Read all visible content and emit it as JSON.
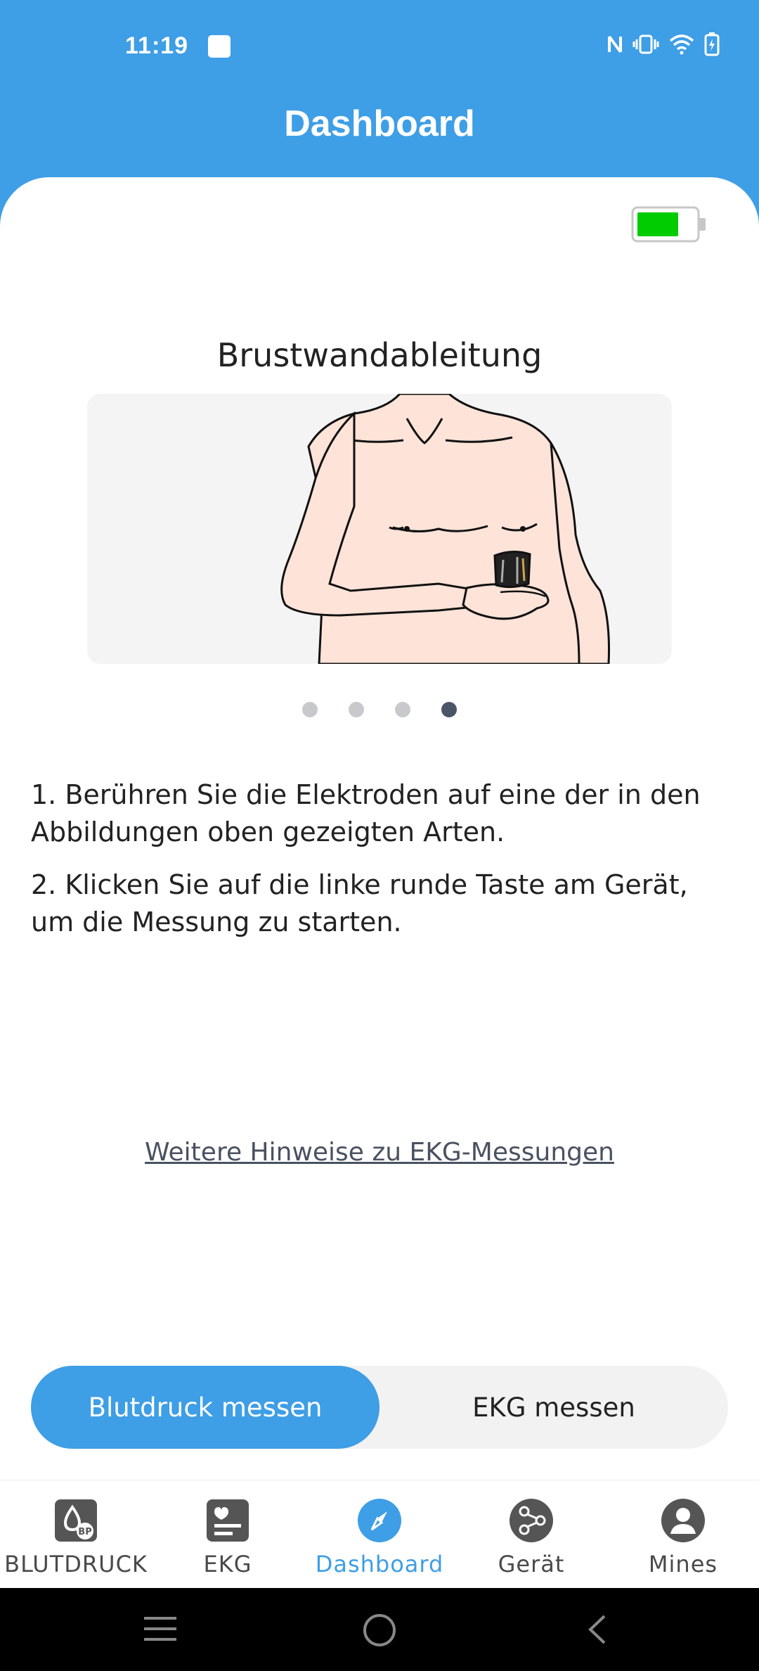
{
  "status_bar": {
    "time": "11:19",
    "icons": [
      "nfc-icon",
      "vibrate-icon",
      "wifi-icon",
      "battery-charging-icon"
    ]
  },
  "app": {
    "title": "Dashboard"
  },
  "device_battery": {
    "level_fraction": 0.85,
    "color": "#00cc00",
    "icon": "battery-icon"
  },
  "carousel": {
    "title": "Brustwandableitung",
    "page_count": 4,
    "active_page": 4
  },
  "instructions": [
    "1. Berühren Sie die Elektroden auf eine der in den Abbildungen oben gezeigten Arten.",
    "2. Klicken Sie auf die linke runde Taste am Gerät, um die Messung zu starten."
  ],
  "more_link": "Weitere Hinweise zu EKG-Messungen",
  "segment": {
    "left_label": "Blutdruck messen",
    "right_label": "EKG messen",
    "active": "left"
  },
  "bottom_nav": {
    "items": [
      {
        "label": "BLUTDRUCK",
        "icon": "blood-pressure-icon"
      },
      {
        "label": "EKG",
        "icon": "ekg-icon"
      },
      {
        "label": "Dashboard",
        "icon": "compass-icon",
        "active": true
      },
      {
        "label": "Gerät",
        "icon": "device-connection-icon"
      },
      {
        "label": "Mines",
        "icon": "profile-icon"
      }
    ]
  },
  "colors": {
    "accent": "#3e9ee6",
    "skin": "#fde3d8",
    "dot_inactive": "#c8c9cd",
    "dot_active": "#4a5568"
  }
}
